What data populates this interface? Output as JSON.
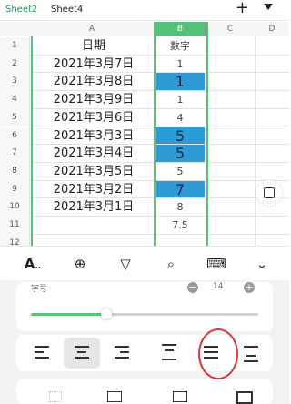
{
  "sheet_tabs": [
    {
      "label": "Sheet2",
      "active": true
    },
    {
      "label": "Sheet4",
      "active": false
    }
  ],
  "add_sheet_label": "+",
  "columns": [
    "A",
    "B",
    "C",
    "D"
  ],
  "rows": [
    {
      "n": "1",
      "a": "日期",
      "b": "数字",
      "hl": false
    },
    {
      "n": "2",
      "a": "2021年3月7日",
      "b": "1",
      "hl": false
    },
    {
      "n": "3",
      "a": "2021年3月8日",
      "b": "1",
      "hl": true
    },
    {
      "n": "4",
      "a": "2021年3月9日",
      "b": "1",
      "hl": false
    },
    {
      "n": "5",
      "a": "2021年3月6日",
      "b": "4",
      "hl": false
    },
    {
      "n": "6",
      "a": "2021年3月3日",
      "b": "5",
      "hl": true
    },
    {
      "n": "7",
      "a": "2021年3月4日",
      "b": "5",
      "hl": true
    },
    {
      "n": "8",
      "a": "2021年3月5日",
      "b": "5",
      "hl": false
    },
    {
      "n": "9",
      "a": "2021年3月2日",
      "b": "7",
      "hl": true
    },
    {
      "n": "10",
      "a": "2021年3月1日",
      "b": "8",
      "hl": false
    },
    {
      "n": "11",
      "a": "",
      "b": "7.5",
      "hl": false
    },
    {
      "n": "12",
      "a": "",
      "b": "",
      "hl": false
    }
  ],
  "toolbar_icons": [
    "text-format-icon",
    "insert-icon",
    "filter-icon",
    "find-icon",
    "keyboard-icon",
    "collapse-icon"
  ],
  "font_size": {
    "label": "字号",
    "value": "14",
    "slider_level": 0.33
  },
  "colors": {
    "selection": "#55c27a",
    "highlight": "#2e9bd6",
    "accent_circle": "#d43a3a"
  }
}
